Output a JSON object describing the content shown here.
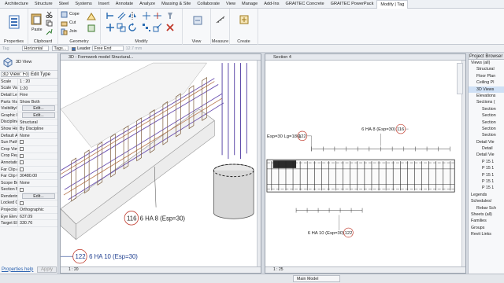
{
  "ribbon_tabs": [
    "Architecture",
    "Structure",
    "Steel",
    "Systems",
    "Insert",
    "Annotate",
    "Analyze",
    "Massing & Site",
    "Collaborate",
    "View",
    "Manage",
    "Add-Ins",
    "GRAITEC Concrete",
    "GRAITEC PowerPack",
    "Modify | Tag"
  ],
  "ribbon": {
    "groups": [
      "Properties",
      "Clipboard",
      "Geometry",
      "Modify",
      "View",
      "Measure",
      "Create"
    ],
    "buttons": {
      "paste": "Paste",
      "cope": "Cope",
      "cut": "Cut",
      "join": "Join"
    }
  },
  "options_bar": {
    "tag_label": "Tag",
    "orientation": "Horizontal",
    "tags_button": "Tags...",
    "leader_checkbox": "Leader",
    "leader_end": "Free End",
    "length": "12.7 mm"
  },
  "properties": {
    "type_label": "3D View",
    "selector": "3D View: Formwork",
    "edit_type": "Edit Type",
    "rows": [
      {
        "k": "Scale",
        "v": "1 : 20"
      },
      {
        "k": "Scale Value",
        "v": "1:20"
      },
      {
        "k": "Detail Level",
        "v": "Fine"
      },
      {
        "k": "Parts Visibility",
        "v": "Show Both"
      },
      {
        "k": "Visibility/Graphics",
        "v": "Edit..."
      },
      {
        "k": "Graphic Display",
        "v": "Edit..."
      },
      {
        "k": "Discipline",
        "v": "Structural"
      },
      {
        "k": "Show Hidden",
        "v": "By Discipline"
      },
      {
        "k": "Default Analysis",
        "v": "None"
      },
      {
        "k": "Sun Path",
        "v": ""
      },
      {
        "k": "Crop View",
        "v": ""
      },
      {
        "k": "Crop Region Visible",
        "v": ""
      },
      {
        "k": "Annotation Crop",
        "v": ""
      },
      {
        "k": "Far Clip Active",
        "v": ""
      },
      {
        "k": "Far Clip Offset",
        "v": "30480.00"
      },
      {
        "k": "Scope Box",
        "v": "None"
      },
      {
        "k": "Section Box",
        "v": ""
      },
      {
        "k": "Rendering Settings",
        "v": "Edit..."
      },
      {
        "k": "Locked Orientation",
        "v": ""
      },
      {
        "k": "Projection Mode",
        "v": "Orthographic"
      },
      {
        "k": "Eye Elevation",
        "v": "637.09"
      },
      {
        "k": "Target Elevation",
        "v": "330.76"
      }
    ],
    "help_link": "Properties help",
    "apply_button": "Apply"
  },
  "view3d": {
    "title": "3D - Formwork model Structural...",
    "tag_a_num": "116",
    "tag_a_text": "6 HA 8 (Esp=30)",
    "tag_b_num": "122",
    "tag_b_text": "6 HA 10 (Esp=30)",
    "scale": "1 : 20"
  },
  "section4": {
    "title": "Section 4",
    "tag_top_left_text": "Esp=30 Lg=186)",
    "tag_top_left_num": "122",
    "tag_top_right_text": "6 HA 8 (Esp=30)",
    "tag_top_right_num": "116",
    "tag_bottom_text": "6 HA 10 (Esp=30)",
    "tag_bottom_num": "122",
    "scale": "1 : 25"
  },
  "browser": {
    "title": "Project Browser - F",
    "items": [
      {
        "label": "Views (all)",
        "indent": 1,
        "sel": false
      },
      {
        "label": "Structural",
        "indent": 2,
        "sel": false
      },
      {
        "label": "Floor Plan",
        "indent": 2,
        "sel": false
      },
      {
        "label": "Ceiling Pl",
        "indent": 2,
        "sel": false
      },
      {
        "label": "3D Views",
        "indent": 2,
        "sel": true
      },
      {
        "label": "Elevations",
        "indent": 2,
        "sel": false
      },
      {
        "label": "Sections (",
        "indent": 2,
        "sel": false
      },
      {
        "label": "Section",
        "indent": 3,
        "sel": false
      },
      {
        "label": "Section",
        "indent": 3,
        "sel": false
      },
      {
        "label": "Section",
        "indent": 3,
        "sel": false
      },
      {
        "label": "Section",
        "indent": 3,
        "sel": false
      },
      {
        "label": "Section",
        "indent": 3,
        "sel": false
      },
      {
        "label": "Detail Vie",
        "indent": 2,
        "sel": false
      },
      {
        "label": "Detail",
        "indent": 3,
        "sel": false
      },
      {
        "label": "Detail Vie",
        "indent": 2,
        "sel": false
      },
      {
        "label": "P 15 1",
        "indent": 3,
        "sel": false
      },
      {
        "label": "P 15 1",
        "indent": 3,
        "sel": false
      },
      {
        "label": "P 15 1",
        "indent": 3,
        "sel": false
      },
      {
        "label": "P 15 1",
        "indent": 3,
        "sel": false
      },
      {
        "label": "P 15 1",
        "indent": 3,
        "sel": false
      },
      {
        "label": "Legends",
        "indent": 1,
        "sel": false
      },
      {
        "label": "Schedules/",
        "indent": 1,
        "sel": false
      },
      {
        "label": "Rebar Sch",
        "indent": 2,
        "sel": false
      },
      {
        "label": "Sheets (all)",
        "indent": 1,
        "sel": false
      },
      {
        "label": "Families",
        "indent": 1,
        "sel": false
      },
      {
        "label": "Groups",
        "indent": 1,
        "sel": false
      },
      {
        "label": "Revit Links",
        "indent": 1,
        "sel": false
      }
    ]
  },
  "status": {
    "model": "Main Model"
  }
}
